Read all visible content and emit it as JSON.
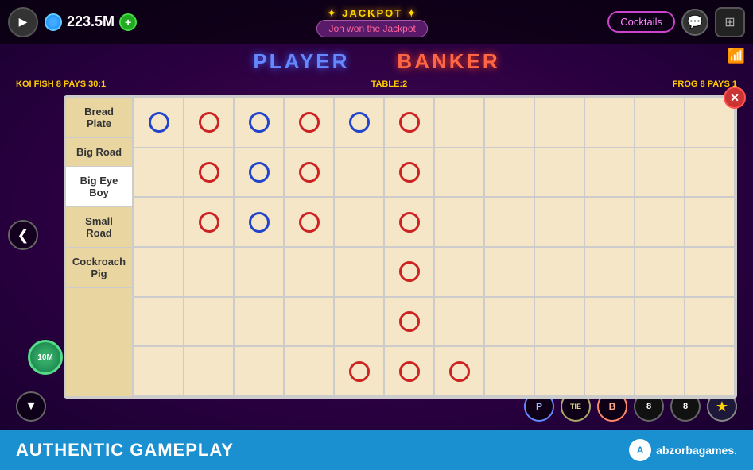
{
  "topbar": {
    "coin_amount": "223.5M",
    "play_icon": "▶",
    "plus_icon": "+",
    "jackpot_title": "✦ JACKPOT ✦",
    "jackpot_message": "Joh won the Jackpot",
    "cocktails_label": "Cocktails",
    "chat_icon": "💬",
    "grid_icon": "⊞"
  },
  "game": {
    "player_label": "PLAYER",
    "banker_label": "BANKER",
    "info_left": "KOI FISH 8 PAYS 30:1",
    "info_center": "TABLE:2",
    "info_right": "FROG 8 PAYS 1",
    "wifi_icon": "📶"
  },
  "scoreboard": {
    "close_icon": "✕",
    "roads": [
      {
        "id": "bread-plate",
        "label": "Bread Plate",
        "active": false
      },
      {
        "id": "big-road",
        "label": "Big Road",
        "active": false
      },
      {
        "id": "big-eye-boy",
        "label": "Big Eye Boy",
        "active": true
      },
      {
        "id": "small-road",
        "label": "Small Road",
        "active": false
      },
      {
        "id": "cockroach-pig",
        "label": "Cockroach Pig",
        "active": false
      }
    ],
    "grid": {
      "cols": 12,
      "rows": 6,
      "circles": [
        {
          "row": 0,
          "col": 0,
          "color": "blue"
        },
        {
          "row": 0,
          "col": 1,
          "color": "red"
        },
        {
          "row": 0,
          "col": 2,
          "color": "blue"
        },
        {
          "row": 0,
          "col": 3,
          "color": "red"
        },
        {
          "row": 0,
          "col": 4,
          "color": "blue"
        },
        {
          "row": 0,
          "col": 5,
          "color": "red"
        },
        {
          "row": 1,
          "col": 1,
          "color": "red"
        },
        {
          "row": 1,
          "col": 2,
          "color": "blue"
        },
        {
          "row": 1,
          "col": 3,
          "color": "red"
        },
        {
          "row": 1,
          "col": 5,
          "color": "red"
        },
        {
          "row": 2,
          "col": 1,
          "color": "red"
        },
        {
          "row": 2,
          "col": 2,
          "color": "blue"
        },
        {
          "row": 2,
          "col": 3,
          "color": "red"
        },
        {
          "row": 2,
          "col": 5,
          "color": "red"
        },
        {
          "row": 3,
          "col": 5,
          "color": "red"
        },
        {
          "row": 4,
          "col": 5,
          "color": "red"
        },
        {
          "row": 5,
          "col": 4,
          "color": "red"
        },
        {
          "row": 5,
          "col": 5,
          "color": "red"
        },
        {
          "row": 5,
          "col": 6,
          "color": "red"
        }
      ]
    }
  },
  "bottom_actions": {
    "down_icon": "▼",
    "p_label": "P",
    "tie_label": "TIE",
    "b_label": "B",
    "ball8_label": "8",
    "ball8_label2": "8",
    "star_icon": "★",
    "left_nav_icon": "❮",
    "chip_label": "10M"
  },
  "footer": {
    "text": "AUTHENTIC GAMEPLAY",
    "brand": "abzorba",
    "brand_suffix": "games."
  }
}
